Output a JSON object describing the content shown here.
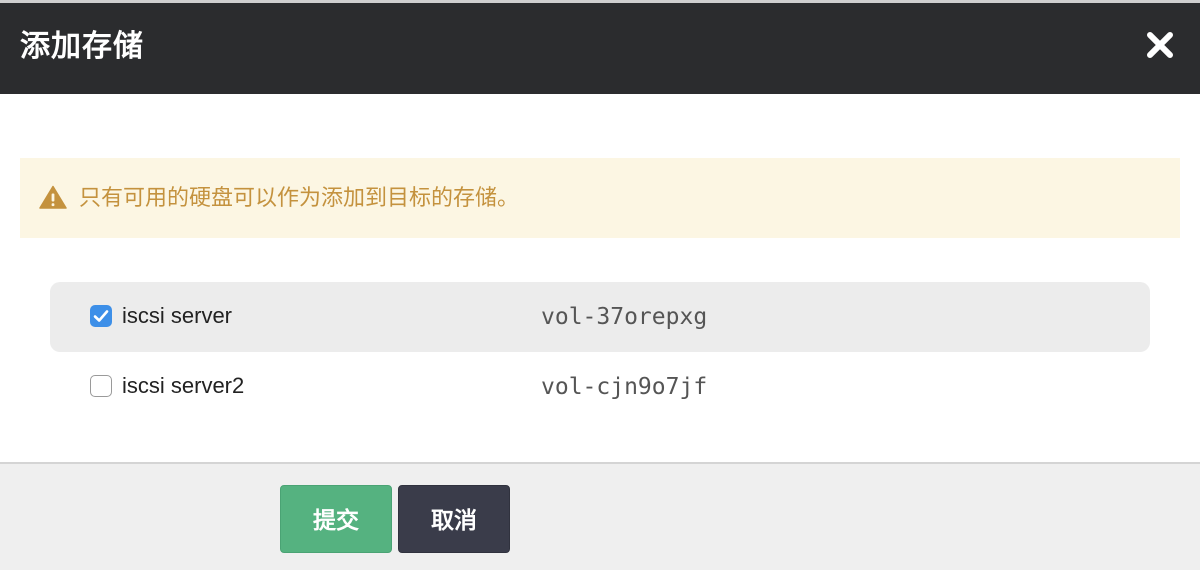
{
  "dialog": {
    "title": "添加存储",
    "close_icon": "close-icon"
  },
  "alert": {
    "icon": "warning-icon",
    "message": "只有可用的硬盘可以作为添加到目标的存储。",
    "color": "#c4923e"
  },
  "volumes": [
    {
      "name": "iscsi server",
      "id": "vol-37orepxg",
      "checked": true
    },
    {
      "name": "iscsi server2",
      "id": "vol-cjn9o7jf",
      "checked": false
    }
  ],
  "footer": {
    "submit_label": "提交",
    "cancel_label": "取消"
  },
  "colors": {
    "header_bg": "#2b2c2e",
    "alert_bg": "#fcf6e3",
    "checkbox_checked": "#3d8fe8",
    "submit_bg": "#55b280",
    "cancel_bg": "#3a3c4a"
  }
}
